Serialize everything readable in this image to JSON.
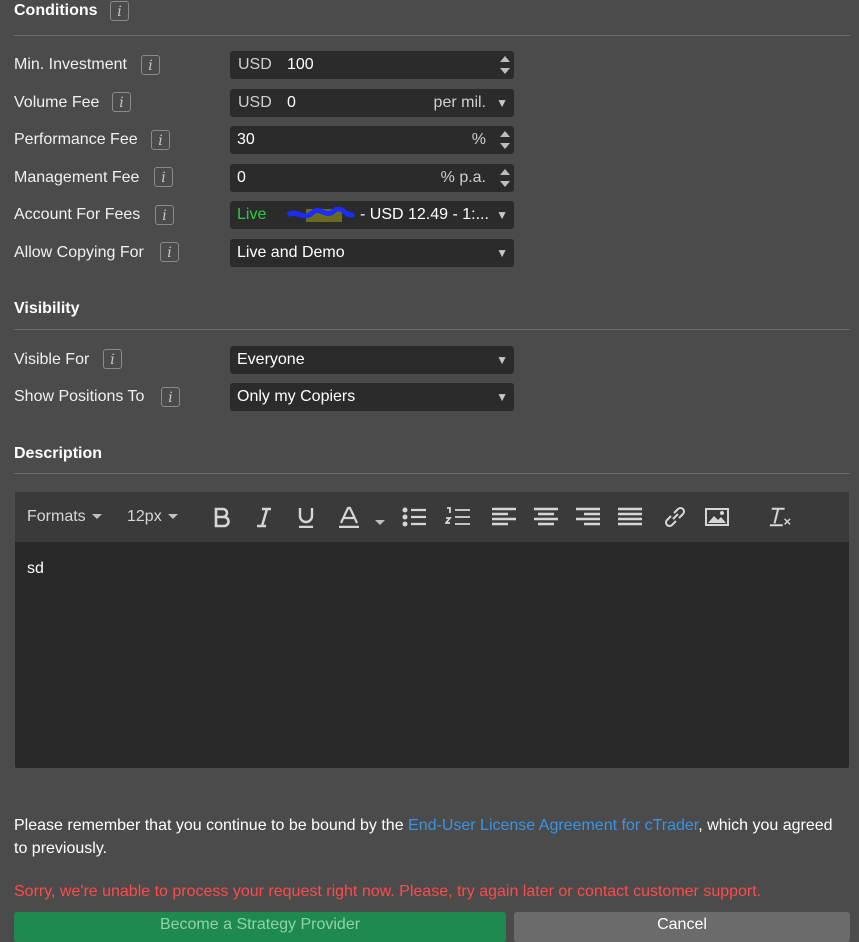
{
  "conditions": {
    "title": "Conditions",
    "info": "i",
    "rows": {
      "min_investment": {
        "label": "Min. Investment",
        "currency": "USD",
        "value": "100"
      },
      "volume_fee": {
        "label": "Volume Fee",
        "currency": "USD",
        "value": "0",
        "suffix": "per mil."
      },
      "performance_fee": {
        "label": "Performance Fee",
        "value": "30",
        "suffix": "%"
      },
      "management_fee": {
        "label": "Management Fee",
        "value": "0",
        "suffix": "% p.a."
      },
      "account_for_fees": {
        "label": "Account For Fees",
        "status": "Live",
        "status_color": "#2ecc40",
        "value": "- USD 12.49 - 1:..."
      },
      "allow_copying": {
        "label": "Allow Copying For",
        "value": "Live and Demo"
      }
    }
  },
  "visibility": {
    "title": "Visibility",
    "rows": {
      "visible_for": {
        "label": "Visible For",
        "value": "Everyone"
      },
      "show_positions": {
        "label": "Show Positions To",
        "value": "Only my Copiers"
      }
    }
  },
  "description": {
    "title": "Description",
    "toolbar": {
      "formats": "Formats",
      "font_size": "12px"
    },
    "content": "sd"
  },
  "notice": {
    "before": "Please remember that you continue to be bound by the ",
    "link": "End-User License Agreement for cTrader",
    "after": ", which you agreed to previously."
  },
  "error": "Sorry, we're unable to process your request right now. Please, try again later or contact customer support.",
  "buttons": {
    "primary": "Become a Strategy Provider",
    "cancel": "Cancel"
  },
  "colors": {
    "link": "#3a93e6",
    "error": "#ff4a4a",
    "primary_button": "#1f8a50"
  }
}
